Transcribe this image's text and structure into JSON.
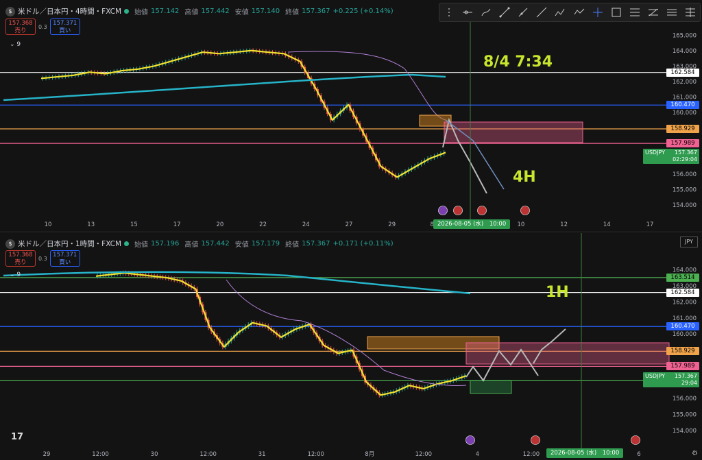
{
  "colors": {
    "up": "#26a69a",
    "down": "#ef5350",
    "yellow": "#f3e22e",
    "cyan": "#26b4c9",
    "purple": "#b07fd4",
    "gray": "#b9b9b9"
  },
  "panel1": {
    "title": "米ドル／日本円・4時間・FXCM",
    "o_label": "始値",
    "o": "157.142",
    "h_label": "高値",
    "h": "157.442",
    "l_label": "安値",
    "l": "157.140",
    "c_label": "終値",
    "c": "157.367",
    "chg": "+0.225 (+0.14%)",
    "sell_price": "157.368",
    "sell_label": "売り",
    "spread": "0.3",
    "buy_price": "157.371",
    "buy_label": "買い",
    "indicator": "9",
    "annotation_time": "8/4 7:34",
    "annotation_tf": "4H",
    "symbol_label": "USDJPY",
    "symbol_price": "157.367",
    "countdown": "02:29:04",
    "x_highlight": "2026-08-05 (水)　10:00"
  },
  "panel2": {
    "title": "米ドル／日本円・1時間・FXCM",
    "o_label": "始値",
    "o": "157.196",
    "h_label": "高値",
    "h": "157.442",
    "l_label": "安値",
    "l": "157.179",
    "c_label": "終値",
    "c": "157.367",
    "chg": "+0.171 (+0.11%)",
    "sell_price": "157.368",
    "sell_label": "売り",
    "spread": "0.3",
    "buy_price": "157.371",
    "buy_label": "買い",
    "indicator": "9",
    "annotation_tf": "1H",
    "currency": "JPY",
    "symbol_label": "USDJPY",
    "symbol_price": "157.367",
    "countdown": "29:04",
    "x_highlight": "2026-08-05 (水)　10:00"
  },
  "logo": "17",
  "chart_data": [
    {
      "type": "line",
      "title": "米ドル／日本円・4時間・FXCM",
      "ylim": [
        153.6,
        165.5
      ],
      "y_ticks": [
        "165.000",
        "164.000",
        "163.000",
        "162.000",
        "161.000",
        "160.000",
        "156.000",
        "155.000",
        "154.000"
      ],
      "x_ticks": [
        "10",
        "13",
        "15",
        "17",
        "20",
        "22",
        "24",
        "27",
        "29",
        "8月",
        "7",
        "10",
        "12",
        "14",
        "17"
      ],
      "levels": [
        {
          "value": 162.584,
          "label": "162.584",
          "color": "#ffffff"
        },
        {
          "value": 160.47,
          "label": "160.470",
          "color": "#2962ff"
        },
        {
          "value": 158.929,
          "label": "158.929",
          "color": "#f0a34a"
        },
        {
          "value": 157.989,
          "label": "157.989",
          "color": "#f06292"
        }
      ],
      "series": [
        {
          "values": [
            162.2,
            162.3,
            162.4,
            162.6,
            162.5,
            162.7,
            162.8,
            163.0,
            163.3,
            163.6,
            163.9,
            163.8,
            163.9,
            164.0,
            163.9,
            163.8,
            163.3,
            161.5,
            159.5,
            160.5,
            158.5,
            156.5,
            155.8,
            156.4,
            157.0,
            157.4
          ]
        }
      ]
    },
    {
      "type": "line",
      "title": "米ドル／日本円・1時間・FXCM",
      "ylim": [
        153.4,
        165.0
      ],
      "y_ticks": [
        "164.000",
        "163.000",
        "162.000",
        "161.000",
        "160.000",
        "156.000",
        "155.000",
        "154.000"
      ],
      "x_ticks": [
        "29",
        "12:00",
        "30",
        "12:00",
        "31",
        "12:00",
        "8月",
        "12:00",
        "4",
        "12:00",
        "5",
        "6"
      ],
      "levels": [
        {
          "value": 163.514,
          "label": "163.514",
          "color": "#4caf50"
        },
        {
          "value": 162.584,
          "label": "162.584",
          "color": "#ffffff"
        },
        {
          "value": 160.47,
          "label": "160.470",
          "color": "#2962ff"
        },
        {
          "value": 158.929,
          "label": "158.929",
          "color": "#f0a34a"
        },
        {
          "value": 157.989,
          "label": "157.989",
          "color": "#f06292"
        },
        {
          "value": 157.095,
          "label": "157.095",
          "color": "#4caf50"
        }
      ],
      "series": [
        {
          "values": [
            163.6,
            163.7,
            163.8,
            163.7,
            163.6,
            163.5,
            163.3,
            162.8,
            160.4,
            159.2,
            160.1,
            160.7,
            160.5,
            159.8,
            160.3,
            160.6,
            159.3,
            158.8,
            159.0,
            157.0,
            156.2,
            156.4,
            156.8,
            156.6,
            156.9,
            157.1,
            157.4
          ]
        }
      ]
    }
  ]
}
